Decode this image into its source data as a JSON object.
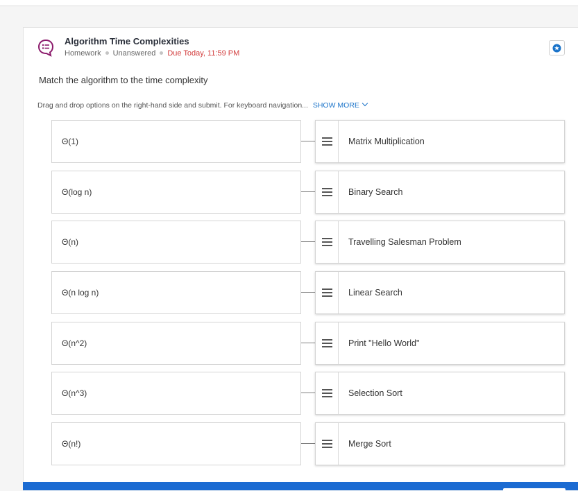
{
  "question": {
    "title": "Algorithm Time Complexities",
    "type": "Homework",
    "status": "Unanswered",
    "due": "Due Today, 11:59 PM",
    "prompt": "Match the algorithm to the time complexity",
    "instructions": "Drag and drop options on the right-hand side and submit. For keyboard navigation...",
    "show_more": "SHOW MORE"
  },
  "pairs": [
    {
      "left": "Θ(1)",
      "right": "Matrix Multiplication"
    },
    {
      "left": "Θ(log n)",
      "right": "Binary Search"
    },
    {
      "left": "Θ(n)",
      "right": "Travelling Salesman Problem"
    },
    {
      "left": "Θ(n log n)",
      "right": "Linear Search"
    },
    {
      "left": "Θ(n^2)",
      "right": "Print \"Hello World\""
    },
    {
      "left": "Θ(n^3)",
      "right": "Selection Sort"
    },
    {
      "left": "Θ(n!)",
      "right": "Merge Sort"
    }
  ],
  "icons": {
    "question": "question-list-icon",
    "star": "star-icon",
    "drag": "drag-handle-icon",
    "chevron": "chevron-down-icon"
  },
  "colors": {
    "accent": "#1a73c9",
    "due": "#d23d3d",
    "question_icon": "#8b1a6b",
    "footer": "#1b6bd2"
  }
}
